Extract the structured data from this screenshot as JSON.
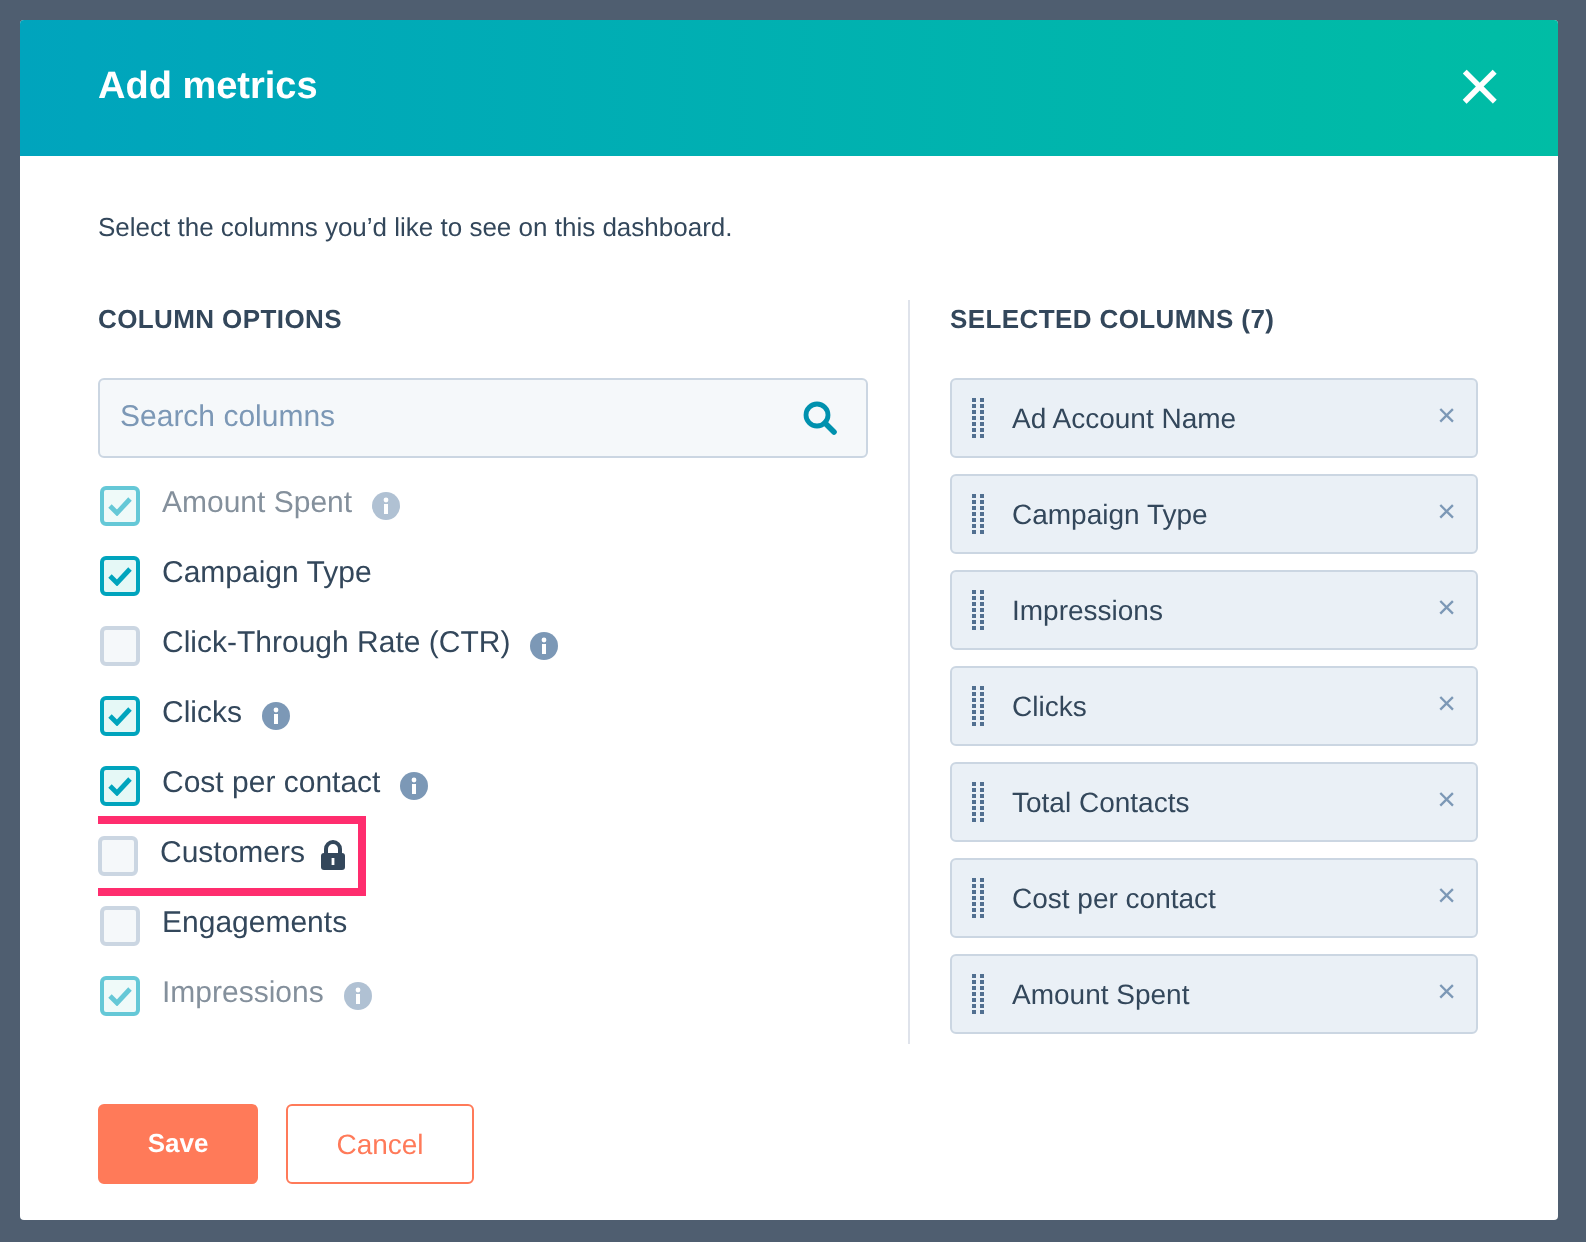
{
  "dialog": {
    "title": "Add metrics",
    "close": "×"
  },
  "intro": "Select the columns you’d like to see on this dashboard.",
  "column_options": {
    "heading": "COLUMN OPTIONS",
    "search": {
      "placeholder": "Search columns"
    },
    "items": [
      {
        "label": "Amount Spent",
        "checked": true,
        "info": true,
        "locked": false,
        "highlighted": false,
        "faded": true
      },
      {
        "label": "Campaign Type",
        "checked": true,
        "info": false,
        "locked": false,
        "highlighted": false,
        "faded": false
      },
      {
        "label": "Click-Through Rate (CTR)",
        "checked": false,
        "info": true,
        "locked": false,
        "highlighted": false,
        "faded": false
      },
      {
        "label": "Clicks",
        "checked": true,
        "info": true,
        "locked": false,
        "highlighted": false,
        "faded": false
      },
      {
        "label": "Cost per contact",
        "checked": true,
        "info": true,
        "locked": false,
        "highlighted": false,
        "faded": false
      },
      {
        "label": "Customers",
        "checked": false,
        "info": false,
        "locked": true,
        "highlighted": true,
        "faded": false
      },
      {
        "label": "Engagements",
        "checked": false,
        "info": false,
        "locked": false,
        "highlighted": false,
        "faded": false
      },
      {
        "label": "Impressions",
        "checked": true,
        "info": true,
        "locked": false,
        "highlighted": false,
        "faded": true
      }
    ]
  },
  "selected_columns": {
    "heading": "SELECTED COLUMNS (7)",
    "remove": "×",
    "items": [
      "Ad Account Name",
      "Campaign Type",
      "Impressions",
      "Clicks",
      "Total Contacts",
      "Cost per contact",
      "Amount Spent"
    ]
  },
  "buttons": [
    {
      "label": "Save",
      "kind": "primary"
    },
    {
      "label": "Cancel",
      "kind": "secondary"
    }
  ]
}
